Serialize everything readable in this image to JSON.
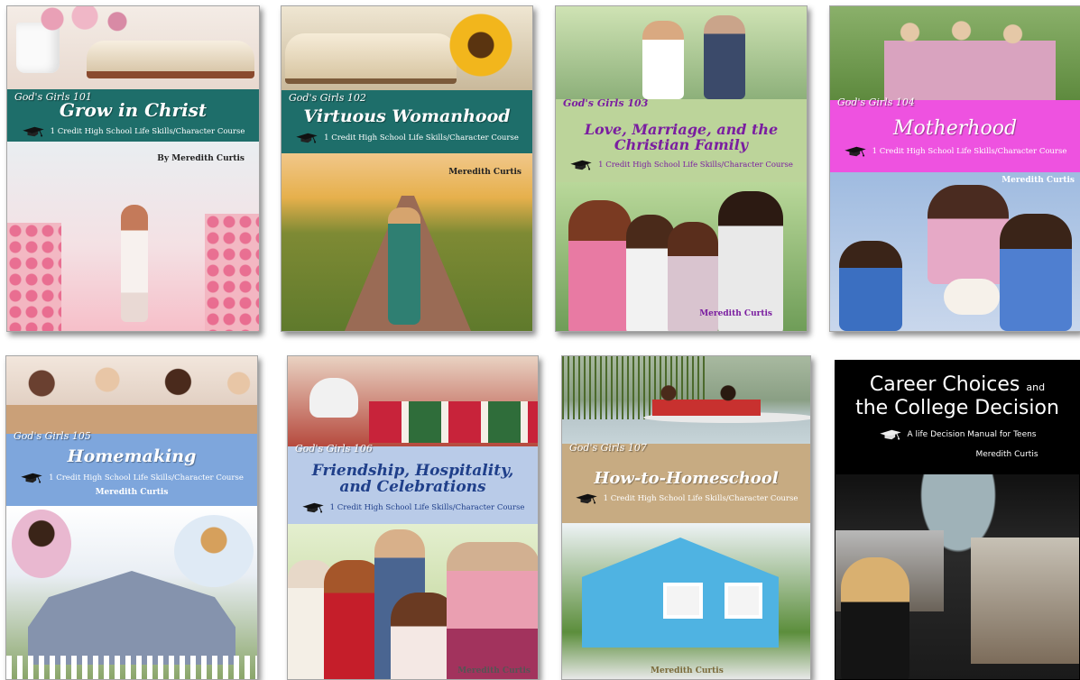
{
  "books": [
    {
      "series": "God's Girls 101",
      "title": "Grow in Christ",
      "subtitle": "1 Credit High School Life Skills/Character Course",
      "author": "By Meredith Curtis",
      "icon": "graduation-cap-icon",
      "colors": {
        "band": "#1e6e6a",
        "scene_top": "#f3e3da",
        "scene_bottom": "#f7c8cf"
      }
    },
    {
      "series": "God's Girls 102",
      "title": "Virtuous Womanhood",
      "subtitle": "1 Credit High School Life Skills/Character Course",
      "author": "Meredith Curtis",
      "icon": "graduation-cap-icon",
      "colors": {
        "band": "#1e6e6a",
        "scene_top": "#f2c44c",
        "scene_bottom": "#7a8c3a"
      }
    },
    {
      "series": "God's Girls 103",
      "title": "Love, Marriage, and the Christian Family",
      "subtitle": "1 Credit High School Life Skills/Character Course",
      "author": "Meredith Curtis",
      "icon": "graduation-cap-icon",
      "colors": {
        "band": "#bcd49a",
        "title_color": "#7a1ea0"
      }
    },
    {
      "series": "God's Girls 104",
      "title": "Motherhood",
      "subtitle": "1 Credit High School Life Skills/Character Course",
      "author": "Meredith Curtis",
      "icon": "graduation-cap-icon",
      "colors": {
        "band": "#ee52e0"
      }
    },
    {
      "series": "God's Girls 105",
      "title": "Homemaking",
      "subtitle": "1 Credit High School Life Skills/Character Course",
      "author": "Meredith Curtis",
      "icon": "graduation-cap-icon",
      "colors": {
        "band": "#7ea6dc"
      }
    },
    {
      "series": "God's Girls 106",
      "title": "Friendship, Hospitality, and Celebrations",
      "subtitle": "1 Credit High School Life Skills/Character Course",
      "author": "Meredith Curtis",
      "icon": "graduation-cap-icon",
      "colors": {
        "band": "#b9cbe8",
        "title_color": "#1f3f8a"
      }
    },
    {
      "series": "God's Girls 107",
      "title": "How-to-Homeschool",
      "subtitle": "1 Credit High School Life Skills/Character Course",
      "author": "Meredith Curtis",
      "icon": "graduation-cap-icon",
      "colors": {
        "band": "#c7ab82"
      }
    },
    {
      "title_line1": "Career Choices",
      "title_and": "and",
      "title_line2": "the College Decision",
      "subtitle": "A life Decision Manual for Teens",
      "author": "Meredith Curtis",
      "icon": "graduation-cap-icon",
      "colors": {
        "background": "#000000"
      }
    }
  ]
}
